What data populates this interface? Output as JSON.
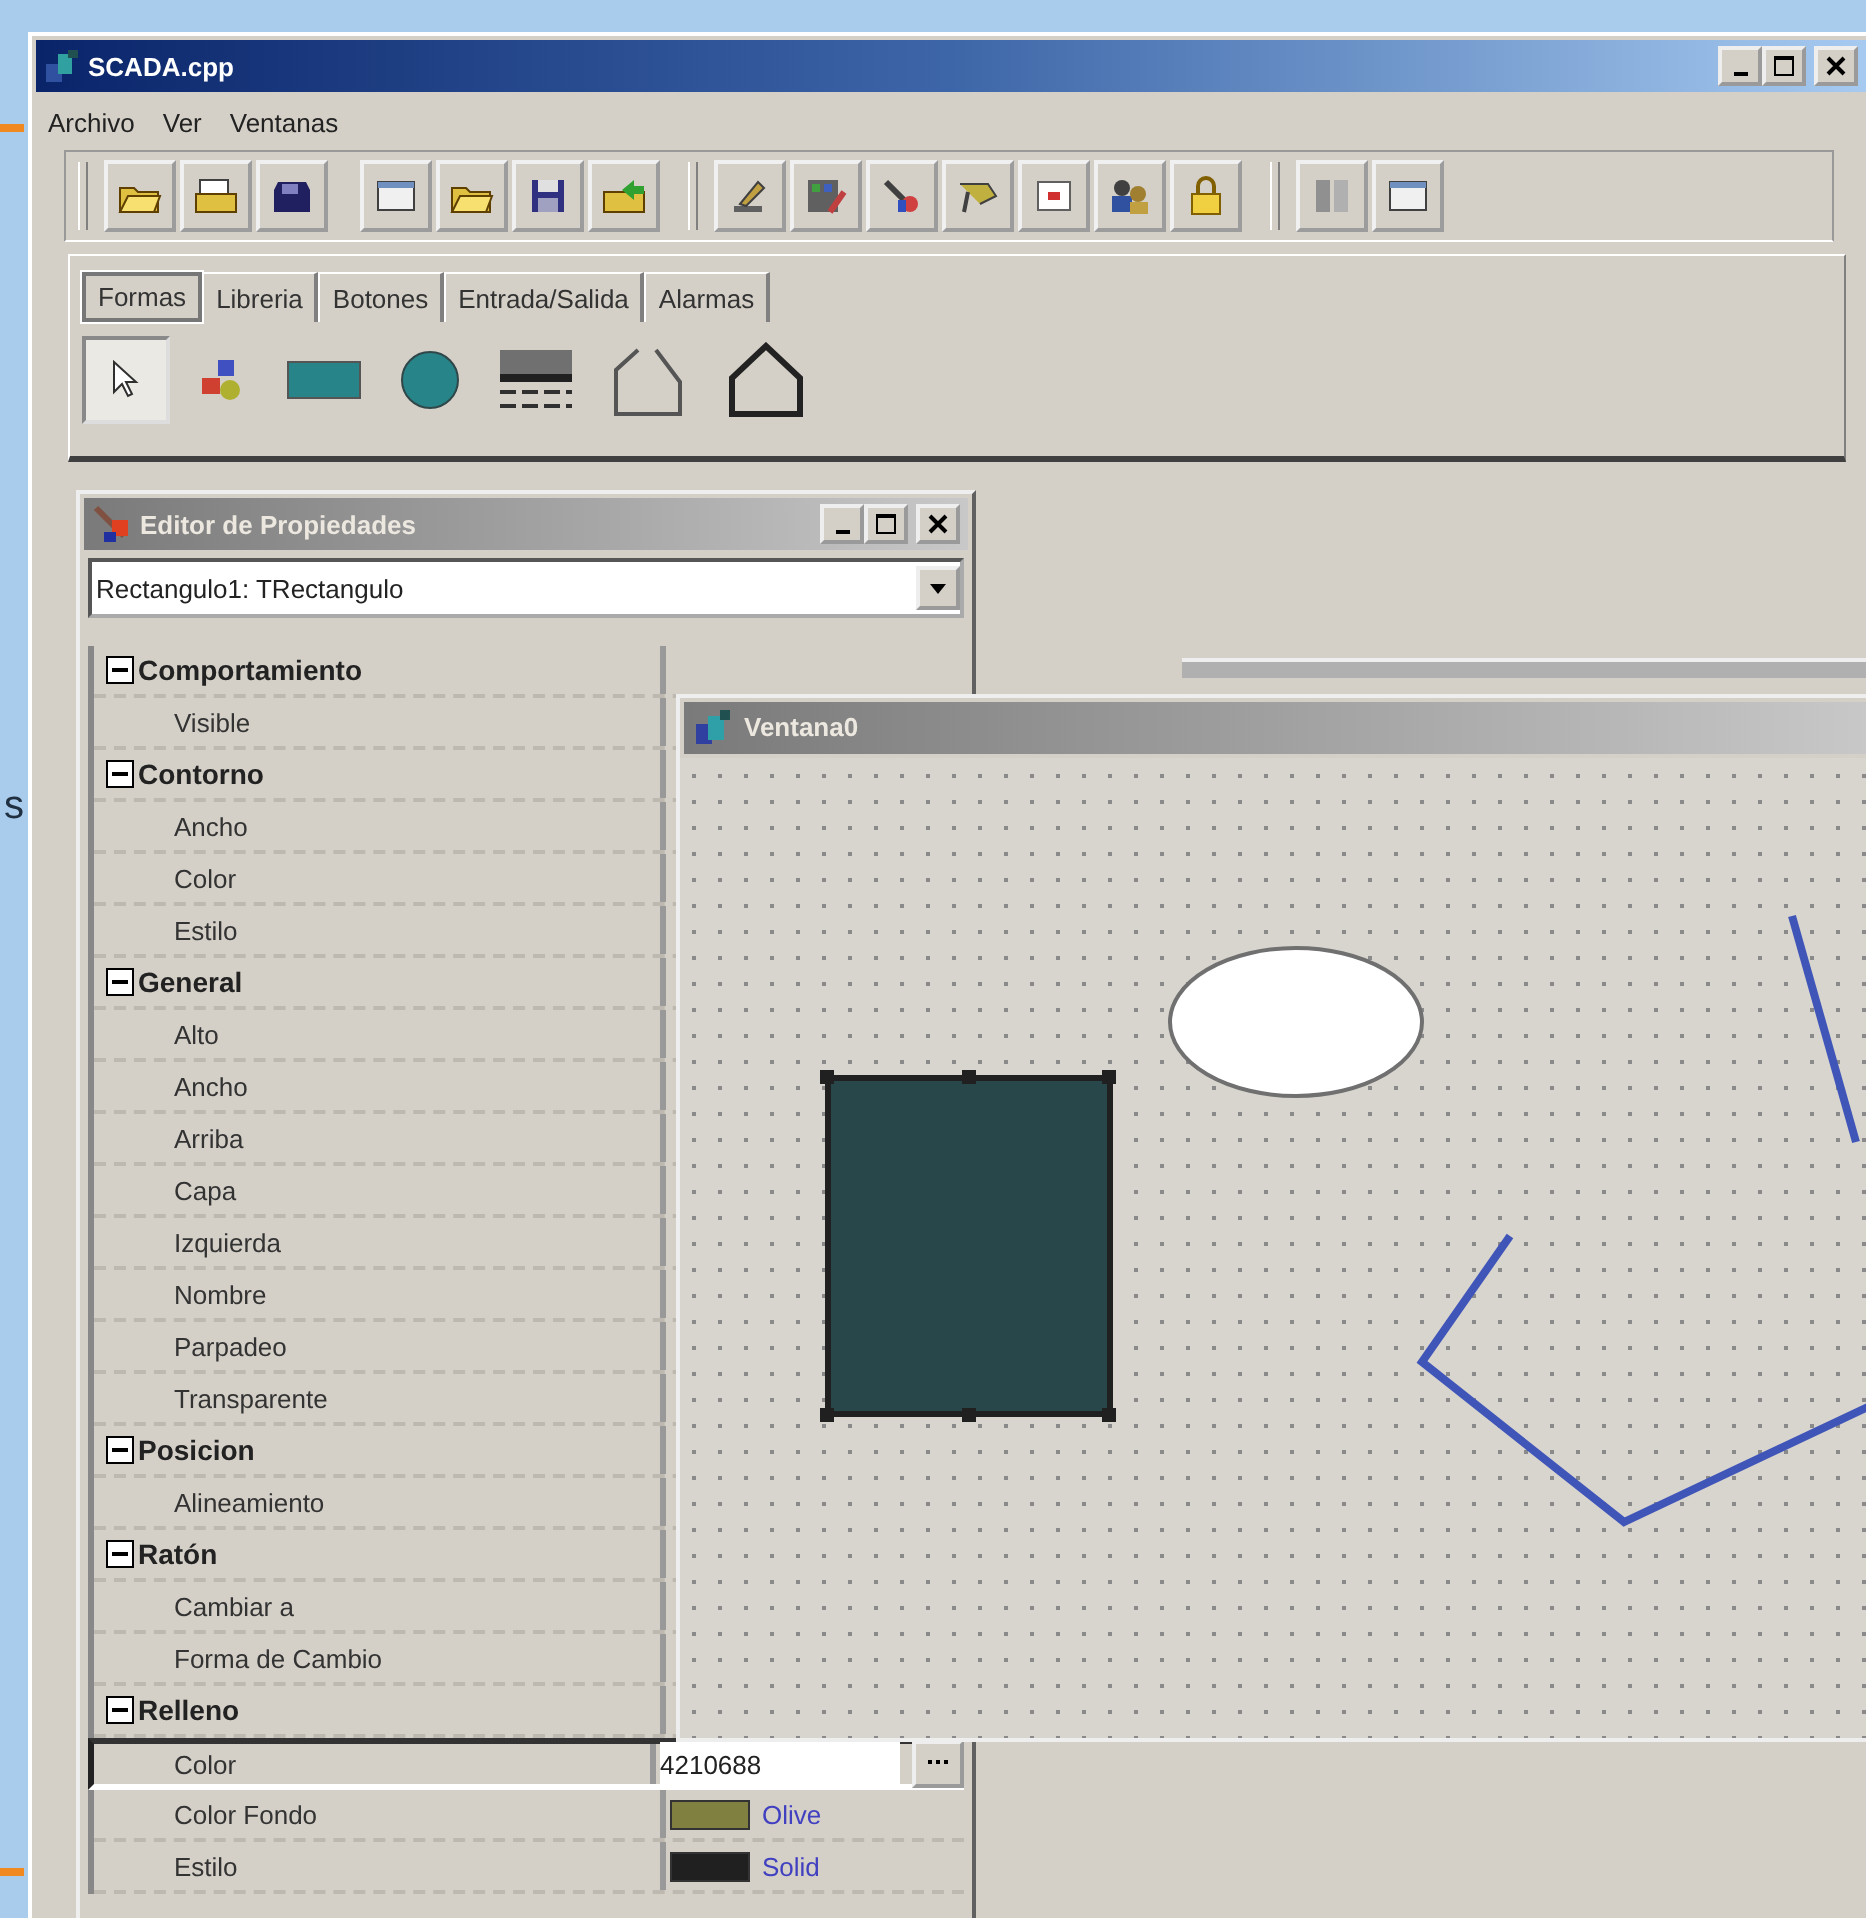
{
  "window": {
    "title": "SCADA.cpp"
  },
  "background_text": "s",
  "menu": [
    "Archivo",
    "Ver",
    "Ventanas"
  ],
  "tabs": [
    {
      "label": "Formas",
      "selected": true
    },
    {
      "label": "Libreria",
      "selected": false
    },
    {
      "label": "Botones",
      "selected": false
    },
    {
      "label": "Entrada/Salida",
      "selected": false
    },
    {
      "label": "Alarmas",
      "selected": false
    }
  ],
  "palette": [
    {
      "kind": "pointer",
      "selected": true
    },
    {
      "kind": "group",
      "selected": false
    },
    {
      "kind": "rectangle",
      "selected": false
    },
    {
      "kind": "circle",
      "selected": false
    },
    {
      "kind": "lines",
      "selected": false
    },
    {
      "kind": "polygon",
      "selected": false
    },
    {
      "kind": "polygon",
      "selected": false
    }
  ],
  "property_editor": {
    "title": "Editor de Propiedades",
    "object": "Rectangulo1: TRectangulo",
    "groups": [
      {
        "name": "Comportamiento",
        "expanded": true,
        "children": [
          {
            "name": "Visible"
          }
        ]
      },
      {
        "name": "Contorno",
        "expanded": true,
        "children": [
          {
            "name": "Ancho"
          },
          {
            "name": "Color"
          },
          {
            "name": "Estilo"
          }
        ]
      },
      {
        "name": "General",
        "expanded": true,
        "children": [
          {
            "name": "Alto"
          },
          {
            "name": "Ancho"
          },
          {
            "name": "Arriba"
          },
          {
            "name": "Capa"
          },
          {
            "name": "Izquierda"
          },
          {
            "name": "Nombre"
          },
          {
            "name": "Parpadeo"
          },
          {
            "name": "Transparente"
          }
        ]
      },
      {
        "name": "Posicion",
        "expanded": true,
        "children": [
          {
            "name": "Alineamiento"
          }
        ]
      },
      {
        "name": "Ratón",
        "expanded": true,
        "children": [
          {
            "name": "Cambiar a"
          },
          {
            "name": "Forma de Cambio"
          }
        ]
      },
      {
        "name": "Relleno",
        "expanded": true,
        "children": [
          {
            "name": "Color",
            "selected": true,
            "value": "4210688"
          },
          {
            "name": "Color Fondo",
            "selected": false,
            "value": "Olive",
            "color": "#808040"
          },
          {
            "name": "Estilo",
            "selected": false,
            "value": "Solid",
            "color": "#202020"
          }
        ]
      }
    ]
  },
  "canvas_window": {
    "title": "Ventana0"
  }
}
